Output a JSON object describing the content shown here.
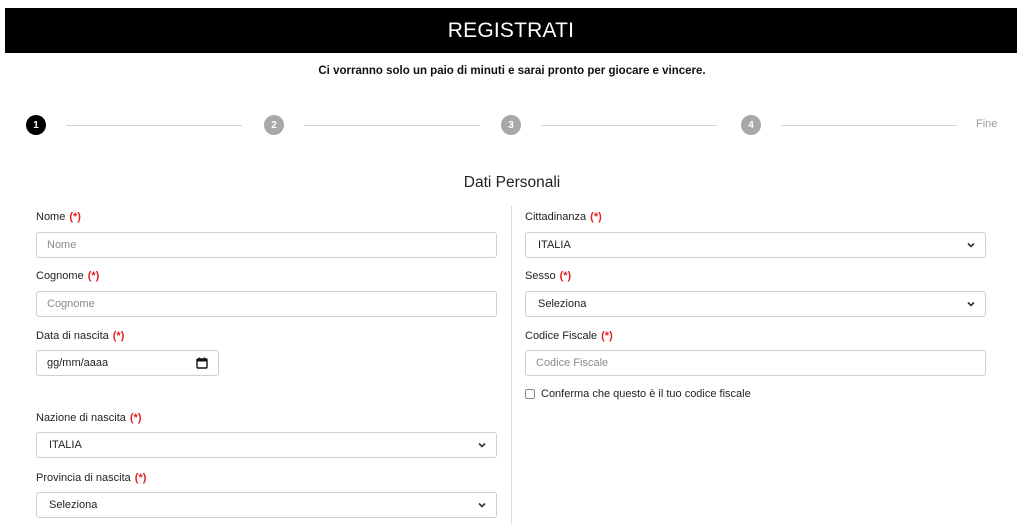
{
  "header": {
    "title": "REGISTRATI"
  },
  "subtitle": "Ci vorranno solo un paio di minuti e sarai pronto per giocare e vincere.",
  "stepper": {
    "steps": [
      "1",
      "2",
      "3",
      "4"
    ],
    "end_label": "Fine",
    "active_step": 1
  },
  "section_title": "Dati Personali",
  "required_marker": "(*)",
  "left": {
    "nome": {
      "label": "Nome",
      "placeholder": "Nome"
    },
    "cognome": {
      "label": "Cognome",
      "placeholder": "Cognome"
    },
    "data_nascita": {
      "label": "Data di nascita",
      "value": "gg/mm/aaaa"
    },
    "nazione_nascita": {
      "label": "Nazione di nascita",
      "value": "ITALIA"
    },
    "provincia_nascita": {
      "label": "Provincia di nascita",
      "value": "Seleziona"
    }
  },
  "right": {
    "cittadinanza": {
      "label": "Cittadinanza",
      "value": "ITALIA"
    },
    "sesso": {
      "label": "Sesso",
      "value": "Seleziona"
    },
    "codice_fiscale": {
      "label": "Codice Fiscale",
      "placeholder": "Codice Fiscale"
    },
    "conferma": {
      "label": "Conferma che questo è il tuo codice fiscale",
      "checked": false
    }
  },
  "colors": {
    "header_bg": "#000000",
    "required": "#e02020",
    "step_active": "#000000",
    "step_inactive": "#a8a8a8"
  }
}
